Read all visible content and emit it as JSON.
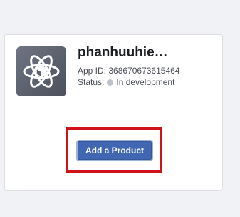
{
  "app": {
    "name": "phanhuuhie…",
    "id_label": "App ID: 368670673615464",
    "status_label": "Status:",
    "status_value": "In development",
    "icon": "atom-cube-icon"
  },
  "actions": {
    "add_product_label": "Add a Product"
  },
  "colors": {
    "page_background": "#f0f2f5",
    "button_blue": "#4267b2",
    "highlight_red": "#d0121b",
    "status_dot_gray": "#bec3c9"
  }
}
